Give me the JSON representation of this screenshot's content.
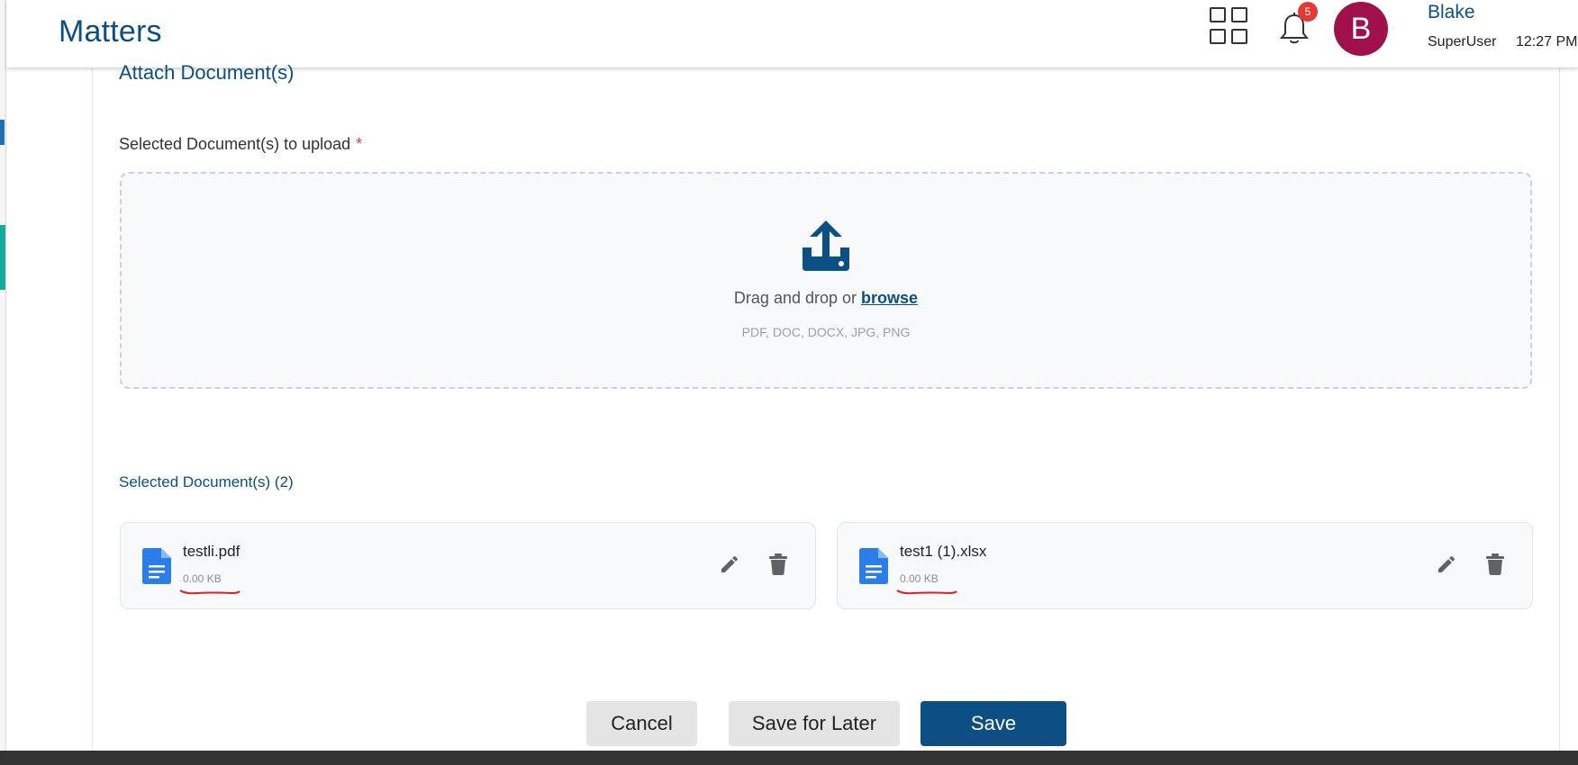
{
  "header": {
    "app_title": "Matters",
    "notification_count": "5",
    "avatar_initial": "B",
    "user_name": "Blake",
    "user_role": "SuperUser",
    "time": "12:27 PM"
  },
  "form": {
    "section_title": "Attach Document(s)",
    "upload_label": "Selected Document(s) to upload",
    "required_mark": "*",
    "drop_text": "Drag and drop or",
    "browse_link": "browse",
    "allowed_types": "PDF, DOC, DOCX, JPG, PNG",
    "selected_title": "Selected Document(s) (2)",
    "files": [
      {
        "name": "testli.pdf",
        "size": "0.00 KB"
      },
      {
        "name": "test1 (1).xlsx",
        "size": "0.00 KB"
      }
    ]
  },
  "actions": {
    "cancel": "Cancel",
    "save_for_later": "Save for Later",
    "save": "Save"
  },
  "colors": {
    "brand": "#0b4f84",
    "avatar": "#a0104a",
    "badge": "#e53935",
    "doc_icon": "#2b7de9",
    "annotation": "#e02020"
  }
}
